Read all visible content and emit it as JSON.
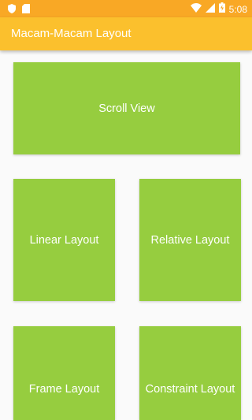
{
  "status_bar": {
    "time": "5:08",
    "icons": [
      "shield-icon",
      "sd-card-icon",
      "wifi-icon",
      "signal-icon",
      "battery-icon"
    ]
  },
  "app_bar": {
    "title": "Macam-Macam Layout"
  },
  "tiles": [
    {
      "label": "Scroll View"
    },
    {
      "label": "Linear Layout"
    },
    {
      "label": "Relative Layout"
    },
    {
      "label": "Frame Layout"
    },
    {
      "label": "Constraint Layout"
    }
  ],
  "colors": {
    "status_bar": "#f9a825",
    "app_bar": "#fbc02d",
    "tile": "#96cd3f",
    "background": "#fafafa"
  }
}
